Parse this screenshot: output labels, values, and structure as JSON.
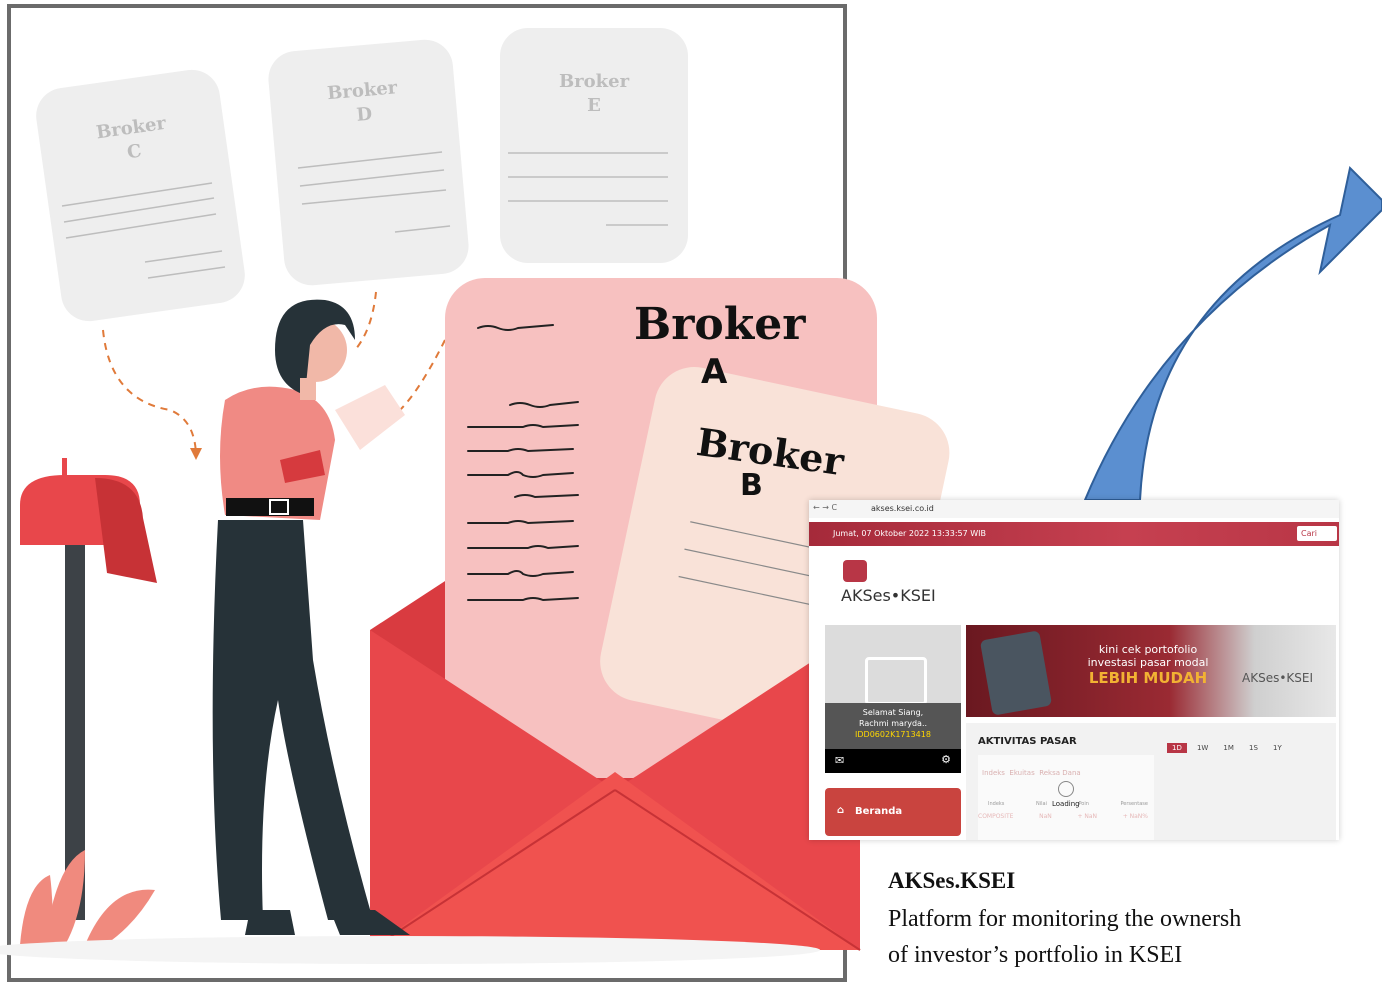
{
  "cards": {
    "c": {
      "line1": "Broker",
      "line2": "C"
    },
    "d": {
      "line1": "Broker",
      "line2": "D"
    },
    "e": {
      "line1": "Broker",
      "line2": "E"
    }
  },
  "doc_a": {
    "line1": "Broker",
    "line2": "A"
  },
  "doc_b": {
    "line1": "Broker",
    "line2": "B"
  },
  "screenshot": {
    "url": "akses.ksei.co.id",
    "datetime": "Jumat, 07 Oktober 2022 13:33:57 WIB",
    "search_button": "Cari",
    "logo_text": "AKSes•KSEI",
    "greeting": "Selamat Siang,",
    "user_name": "Rachmi maryda..",
    "user_id": "IDD0602K1713418",
    "banner_line1": "kini cek portofolio",
    "banner_line2": "investasi pasar modal",
    "banner_line3": "LEBIH MUDAH",
    "banner_logo": "AKSes•KSEI",
    "section_title": "AKTIVITAS PASAR",
    "ranges": [
      "1D",
      "1W",
      "1M",
      "1S",
      "1Y"
    ],
    "tabs": [
      "Indeks",
      "Ekuitas",
      "Reksa Dana"
    ],
    "cols": [
      "Indeks",
      "Nilai",
      "Poin",
      "Persentase"
    ],
    "row": [
      "COMPOSITE",
      "NaN",
      "+ NaN",
      "+ NaN%"
    ],
    "loading": "Loading",
    "nav_home": "Beranda"
  },
  "caption": {
    "title": "AKSes.KSEI",
    "line1": "Platform for monitoring the ownersh",
    "line2": "of investor’s portfolio in KSEI"
  },
  "colors": {
    "arrow": "#5b8fd0",
    "envelope": "#e8474b",
    "pink_doc": "#f7c1c0",
    "peach_doc": "#f9e2d8",
    "brand_red": "#b83646"
  }
}
